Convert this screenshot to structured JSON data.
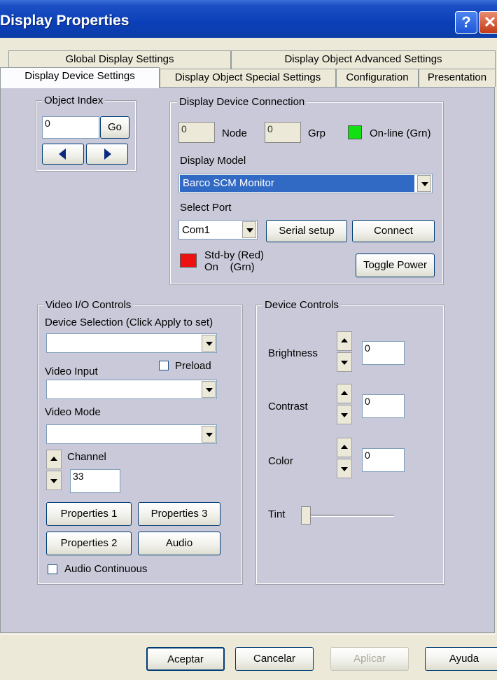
{
  "window": {
    "title": "Display Properties",
    "help_glyph": "?",
    "close_glyph": "✕"
  },
  "tabs": {
    "row1": [
      "Global Display Settings",
      "Display Object Advanced Settings"
    ],
    "row2": [
      "Display Device Settings",
      "Display Object Special Settings",
      "Configuration",
      "Presentation"
    ]
  },
  "object_index": {
    "label": "Object Index",
    "value": "0",
    "go": "Go"
  },
  "connection": {
    "label": "Display Device Connection",
    "node_value": "0",
    "node_label": "Node",
    "grp_value": "0",
    "grp_label": "Grp",
    "online_label": "On-line (Grn)",
    "online_color": "#12e012",
    "model_label": "Display Model",
    "model_value": "Barco SCM Monitor",
    "port_label": "Select Port",
    "port_value": "Com1",
    "serial_setup": "Serial setup",
    "connect": "Connect",
    "standby_line1": "Std-by (Red)",
    "standby_line2": "On    (Grn)",
    "standby_color": "#ee1111",
    "toggle_power": "Toggle Power"
  },
  "video": {
    "label": "Video I/O Controls",
    "device_selection_label": "Device Selection (Click Apply to set)",
    "video_input_label": "Video Input",
    "preload_label": "Preload",
    "video_mode_label": "Video Mode",
    "channel_label": "Channel",
    "channel_value": "33",
    "properties1": "Properties 1",
    "properties3": "Properties 3",
    "properties2": "Properties 2",
    "audio": "Audio",
    "audio_continuous": "Audio Continuous"
  },
  "device_controls": {
    "label": "Device Controls",
    "brightness_label": "Brightness",
    "brightness_value": "0",
    "contrast_label": "Contrast",
    "contrast_value": "0",
    "color_label": "Color",
    "color_value": "0",
    "tint_label": "Tint",
    "tint_level": 0
  },
  "footer": {
    "accept": "Aceptar",
    "cancel": "Cancelar",
    "apply": "Aplicar",
    "help": "Ayuda"
  }
}
